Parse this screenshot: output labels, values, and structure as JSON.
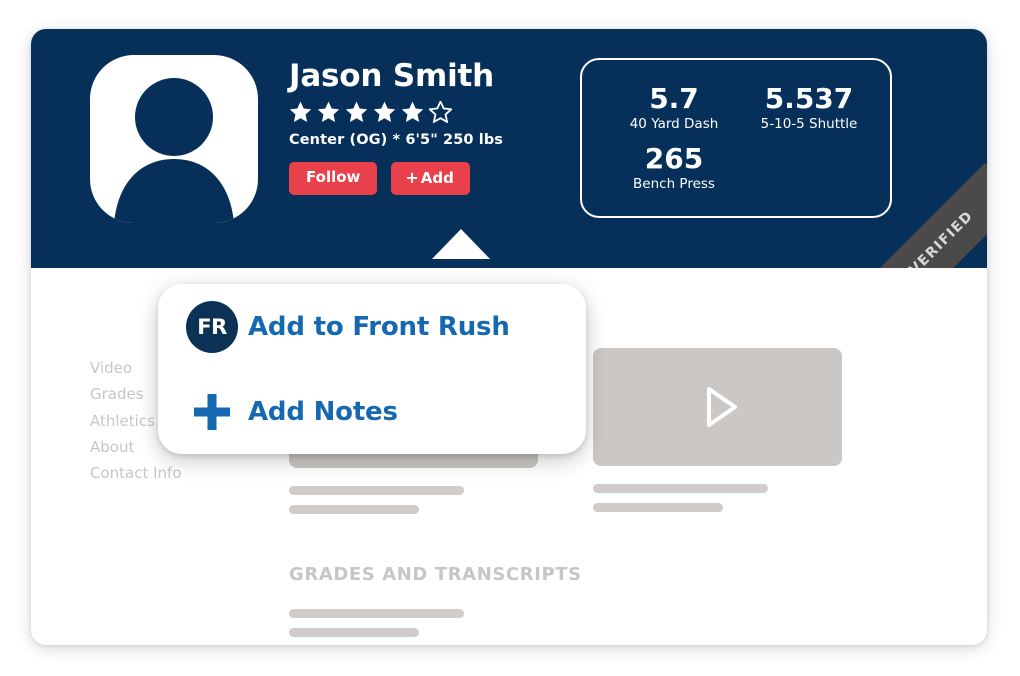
{
  "profile": {
    "name": "Jason Smith",
    "rating": {
      "filled": 5,
      "empty": 1,
      "total": 6
    },
    "meta": "Center (OG) * 6'5\" 250 lbs",
    "avatar_icon": "person-silhouette-icon",
    "verified_ribbon": "VERIFIED",
    "buttons": {
      "follow": "Follow",
      "add": "Add",
      "add_plus": "+"
    }
  },
  "stats": [
    {
      "value": "5.7",
      "label": "40 Yard Dash"
    },
    {
      "value": "5.537",
      "label": "5-10-5 Shuttle"
    },
    {
      "value": "265",
      "label": "Bench Press"
    }
  ],
  "side_nav": [
    {
      "label": "Video"
    },
    {
      "label": "Grades"
    },
    {
      "label": "Athletics"
    },
    {
      "label": "About"
    },
    {
      "label": "Contact Info"
    }
  ],
  "sections": {
    "grades_title": "GRADES AND TRANSCRIPTS"
  },
  "popup": {
    "items": [
      {
        "label": "Add to Front Rush",
        "icon": "front-rush-badge-icon",
        "badge_text": "FR"
      },
      {
        "label": "Add Notes",
        "icon": "plus-icon"
      }
    ]
  },
  "colors": {
    "navy": "#06305a",
    "red": "#e8414c",
    "link_blue": "#1669b0",
    "skeleton_gray": "#cfccc9",
    "ribbon_gray": "#4a4a4a"
  }
}
